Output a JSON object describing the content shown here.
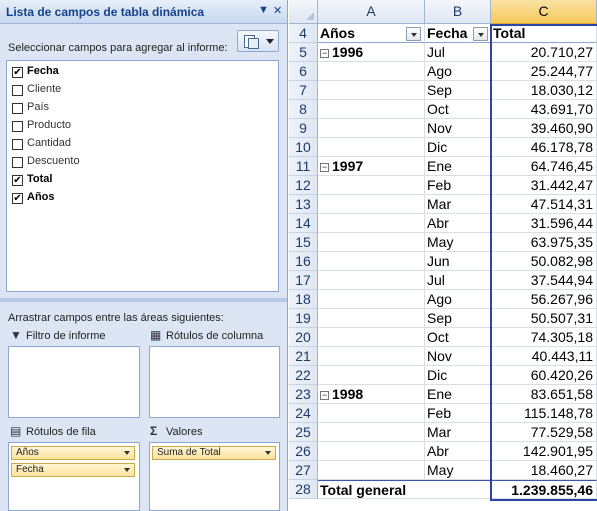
{
  "pane": {
    "title": "Lista de campos de tabla dinámica",
    "dropdown_glyph": "▼",
    "close_glyph": "✕",
    "instruction": "Seleccionar campos para agregar al informe:",
    "settings_icon": "field-list-layout-icon",
    "fields": [
      {
        "label": "Fecha",
        "checked": true
      },
      {
        "label": "Cliente",
        "checked": false
      },
      {
        "label": "País",
        "checked": false
      },
      {
        "label": "Producto",
        "checked": false
      },
      {
        "label": "Cantidad",
        "checked": false
      },
      {
        "label": "Descuento",
        "checked": false
      },
      {
        "label": "Total",
        "checked": true
      },
      {
        "label": "Años",
        "checked": true
      }
    ],
    "drag_instruction": "Arrastrar campos entre las áreas siguientes:",
    "areas": {
      "report_filter": {
        "label": "Filtro de informe",
        "icon": "filter-icon"
      },
      "column_labels": {
        "label": "Rótulos de columna",
        "icon": "column-labels-icon"
      },
      "row_labels": {
        "label": "Rótulos de fila",
        "icon": "row-labels-icon",
        "items": [
          "Años",
          "Fecha"
        ]
      },
      "values": {
        "label": "Valores",
        "icon": "sigma-icon",
        "items": [
          "Suma de Total"
        ]
      }
    }
  },
  "sheet": {
    "columns": [
      "A",
      "B",
      "C"
    ],
    "selected_column": "C",
    "header_row": {
      "row": "4",
      "a": "Años",
      "b": "Fecha",
      "c": "Total"
    },
    "rows": [
      {
        "row": "5",
        "year": "1996",
        "month": "Jul",
        "total": "20.710,27"
      },
      {
        "row": "6",
        "year": "",
        "month": "Ago",
        "total": "25.244,77"
      },
      {
        "row": "7",
        "year": "",
        "month": "Sep",
        "total": "18.030,12"
      },
      {
        "row": "8",
        "year": "",
        "month": "Oct",
        "total": "43.691,70"
      },
      {
        "row": "9",
        "year": "",
        "month": "Nov",
        "total": "39.460,90"
      },
      {
        "row": "10",
        "year": "",
        "month": "Dic",
        "total": "46.178,78"
      },
      {
        "row": "11",
        "year": "1997",
        "month": "Ene",
        "total": "64.746,45"
      },
      {
        "row": "12",
        "year": "",
        "month": "Feb",
        "total": "31.442,47"
      },
      {
        "row": "13",
        "year": "",
        "month": "Mar",
        "total": "47.514,31"
      },
      {
        "row": "14",
        "year": "",
        "month": "Abr",
        "total": "31.596,44"
      },
      {
        "row": "15",
        "year": "",
        "month": "May",
        "total": "63.975,35"
      },
      {
        "row": "16",
        "year": "",
        "month": "Jun",
        "total": "50.082,98"
      },
      {
        "row": "17",
        "year": "",
        "month": "Jul",
        "total": "37.544,94"
      },
      {
        "row": "18",
        "year": "",
        "month": "Ago",
        "total": "56.267,96"
      },
      {
        "row": "19",
        "year": "",
        "month": "Sep",
        "total": "50.507,31"
      },
      {
        "row": "20",
        "year": "",
        "month": "Oct",
        "total": "74.305,18"
      },
      {
        "row": "21",
        "year": "",
        "month": "Nov",
        "total": "40.443,11"
      },
      {
        "row": "22",
        "year": "",
        "month": "Dic",
        "total": "60.420,26"
      },
      {
        "row": "23",
        "year": "1998",
        "month": "Ene",
        "total": "83.651,58"
      },
      {
        "row": "24",
        "year": "",
        "month": "Feb",
        "total": "115.148,78"
      },
      {
        "row": "25",
        "year": "",
        "month": "Mar",
        "total": "77.529,58"
      },
      {
        "row": "26",
        "year": "",
        "month": "Abr",
        "total": "142.901,95"
      },
      {
        "row": "27",
        "year": "",
        "month": "May",
        "total": "18.460,27"
      }
    ],
    "grand_total": {
      "row": "28",
      "label": "Total general",
      "total": "1.239.855,46"
    },
    "collapse_glyph": "⊟"
  }
}
